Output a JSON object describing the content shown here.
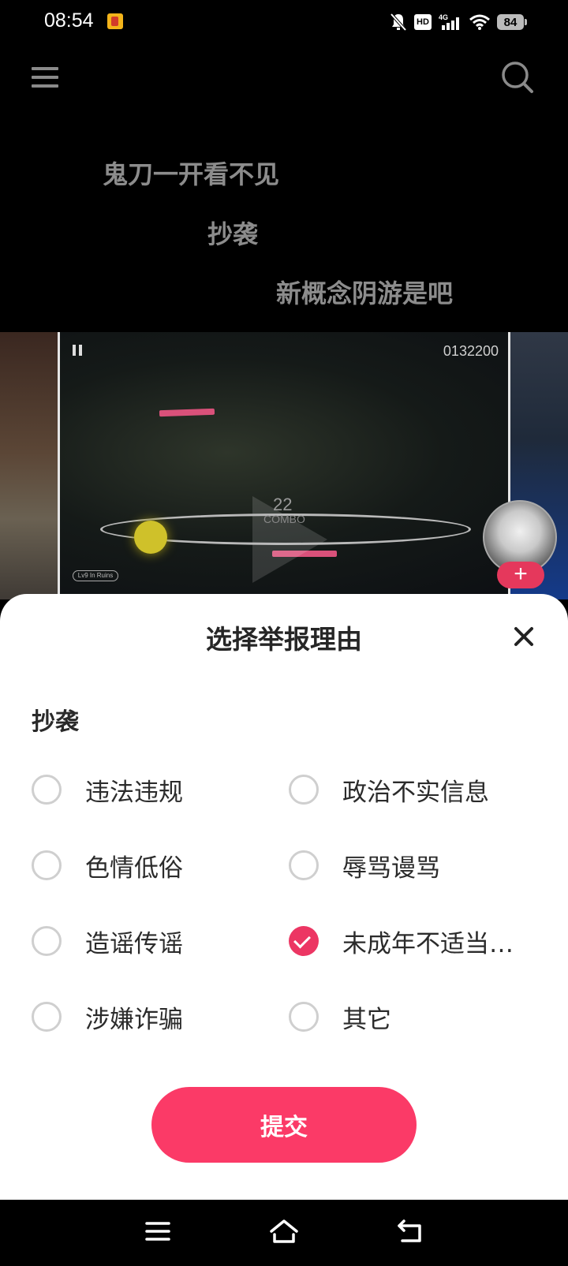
{
  "status_bar": {
    "time": "08:54",
    "network_label": "4G",
    "hd_label": "HD",
    "battery": "84"
  },
  "header": {
    "menu_icon": "menu-icon",
    "search_icon": "search-icon"
  },
  "danmaku": [
    "鬼刀一开看不见",
    "抄袭",
    "新概念阴游是吧"
  ],
  "video": {
    "score": "0132200",
    "combo_count": "22",
    "combo_label": "COMBO",
    "song_tag": "Lv9 In Ruins",
    "follow_label": "+"
  },
  "report_sheet": {
    "title": "选择举报理由",
    "quoted_comment": "抄袭",
    "options": [
      {
        "label": "违法违规",
        "checked": false
      },
      {
        "label": "政治不实信息",
        "checked": false
      },
      {
        "label": "色情低俗",
        "checked": false
      },
      {
        "label": "辱骂谩骂",
        "checked": false
      },
      {
        "label": "造谣传谣",
        "checked": false
      },
      {
        "label": "未成年不适当行为",
        "checked": true
      },
      {
        "label": "涉嫌诈骗",
        "checked": false
      },
      {
        "label": "其它",
        "checked": false
      }
    ],
    "submit_label": "提交",
    "accent_color": "#fb3a67"
  },
  "nav_bar": {
    "icons": [
      "recents-icon",
      "home-icon",
      "back-icon"
    ]
  }
}
